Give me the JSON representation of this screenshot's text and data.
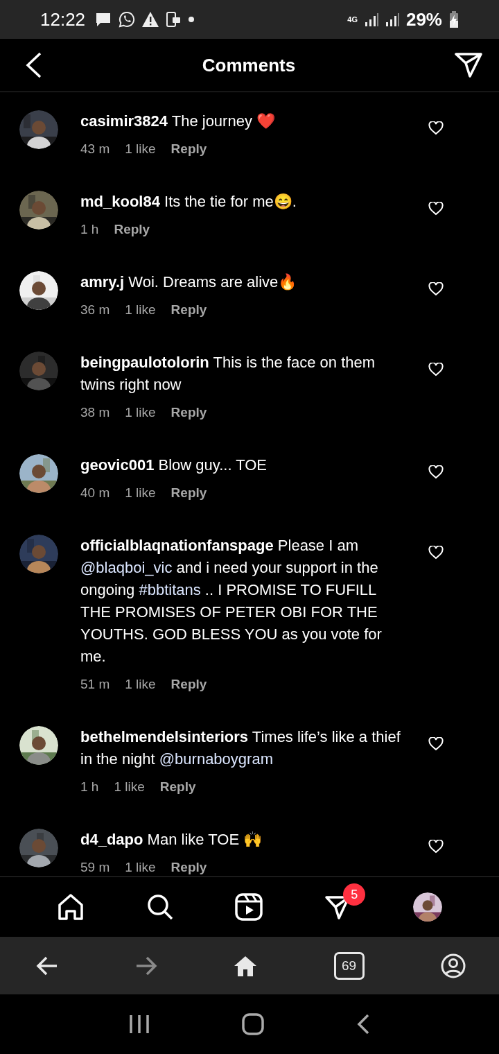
{
  "status_bar": {
    "time": "12:22",
    "network": "4G",
    "battery": "29%"
  },
  "header": {
    "title": "Comments"
  },
  "comments": [
    {
      "username": "casimir3824",
      "parts": [
        {
          "kind": "text",
          "text": "The journey ❤️"
        }
      ],
      "time": "43 m",
      "likes": "1 like",
      "reply": "Reply"
    },
    {
      "username": "md_kool84",
      "parts": [
        {
          "kind": "text",
          "text": "Its the tie for me😄."
        }
      ],
      "time": "1 h",
      "reply": "Reply"
    },
    {
      "username": "amry.j",
      "parts": [
        {
          "kind": "text",
          "text": "Woi. Dreams are alive🔥"
        }
      ],
      "time": "36 m",
      "likes": "1 like",
      "reply": "Reply"
    },
    {
      "username": "beingpaulotolorin",
      "parts": [
        {
          "kind": "text",
          "text": "This is the face on them twins right now"
        }
      ],
      "time": "38 m",
      "likes": "1 like",
      "reply": "Reply"
    },
    {
      "username": "geovic001",
      "parts": [
        {
          "kind": "text",
          "text": "Blow guy... TOE"
        }
      ],
      "time": "40 m",
      "likes": "1 like",
      "reply": "Reply"
    },
    {
      "username": "officialblaqnationfanspage",
      "parts": [
        {
          "kind": "text",
          "text": "Please I am"
        },
        {
          "kind": "mention",
          "text": "@blaqboi_vic"
        },
        {
          "kind": "text",
          "text": "and i need your support in the ongoing"
        },
        {
          "kind": "hashtag",
          "text": "#bbtitans"
        },
        {
          "kind": "text",
          "text": ".. I PROMISE TO FUFILL THE PROMISES OF PETER OBI FOR THE YOUTHS. GOD BLESS YOU as you vote for me."
        }
      ],
      "time": "51 m",
      "likes": "1 like",
      "reply": "Reply"
    },
    {
      "username": "bethelmendelsinteriors",
      "parts": [
        {
          "kind": "text",
          "text": "Times life’s like a thief in the night"
        },
        {
          "kind": "mention",
          "text": "@burnaboygram"
        }
      ],
      "time": "1 h",
      "likes": "1 like",
      "reply": "Reply"
    },
    {
      "username": "d4_dapo",
      "parts": [
        {
          "kind": "text",
          "text": "Man like TOE 🙌"
        }
      ],
      "time": "59 m",
      "likes": "1 like",
      "reply": "Reply"
    }
  ],
  "bottom_nav": {
    "messages_badge": "5"
  },
  "browser_bar": {
    "tab_count": "69"
  }
}
